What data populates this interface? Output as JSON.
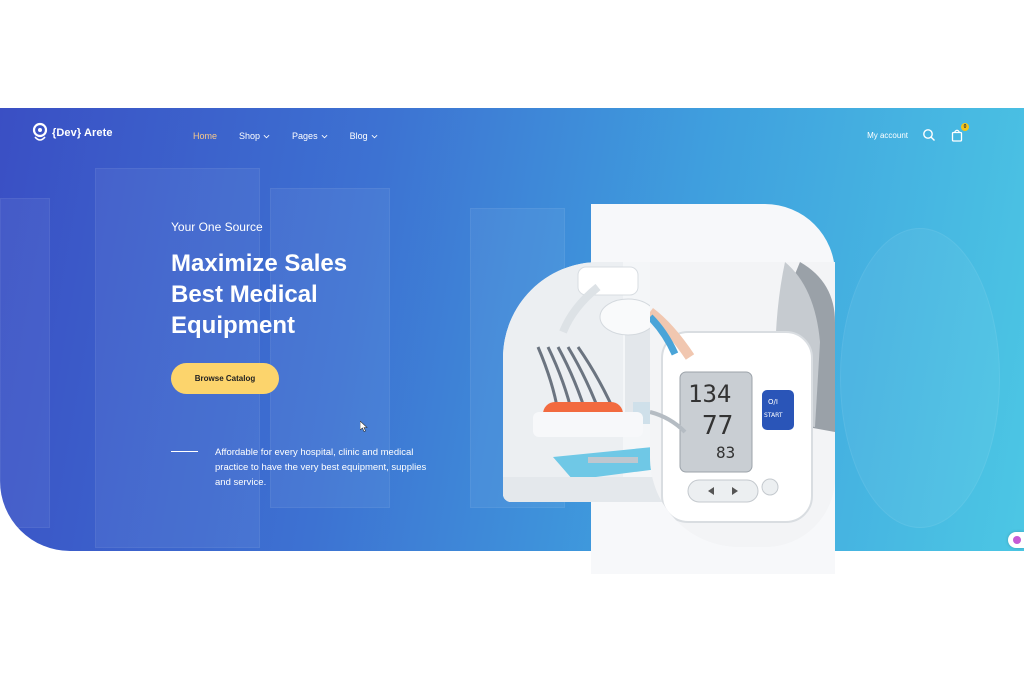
{
  "brand": {
    "name": "{Dev} Arete"
  },
  "nav": {
    "items": [
      {
        "label": "Home",
        "active": true,
        "has_dropdown": false
      },
      {
        "label": "Shop",
        "active": false,
        "has_dropdown": true
      },
      {
        "label": "Pages",
        "active": false,
        "has_dropdown": true
      },
      {
        "label": "Blog",
        "active": false,
        "has_dropdown": true
      }
    ]
  },
  "header_right": {
    "account_label": "My account",
    "search_icon": "search-icon",
    "cart_icon": "shopping-bag-icon",
    "cart_count": "0"
  },
  "hero": {
    "eyebrow": "Your One Source",
    "headline_lines": [
      "Maximize Sales",
      "Best Medical",
      "Equipment"
    ],
    "cta_label": "Browse Catalog",
    "blurb": "Affordable for every hospital, clinic and medical practice to have the very best equipment, supplies and service."
  },
  "bp_monitor": {
    "reading_top": "134",
    "reading_mid": "77",
    "reading_pulse": "83",
    "button_label_1": "O/I",
    "button_label_2": "START"
  },
  "colors": {
    "gradient_start": "#3a4fc4",
    "gradient_end": "#4cc7e4",
    "nav_active": "#f8c98a",
    "cta_bg": "#fcd46c"
  }
}
